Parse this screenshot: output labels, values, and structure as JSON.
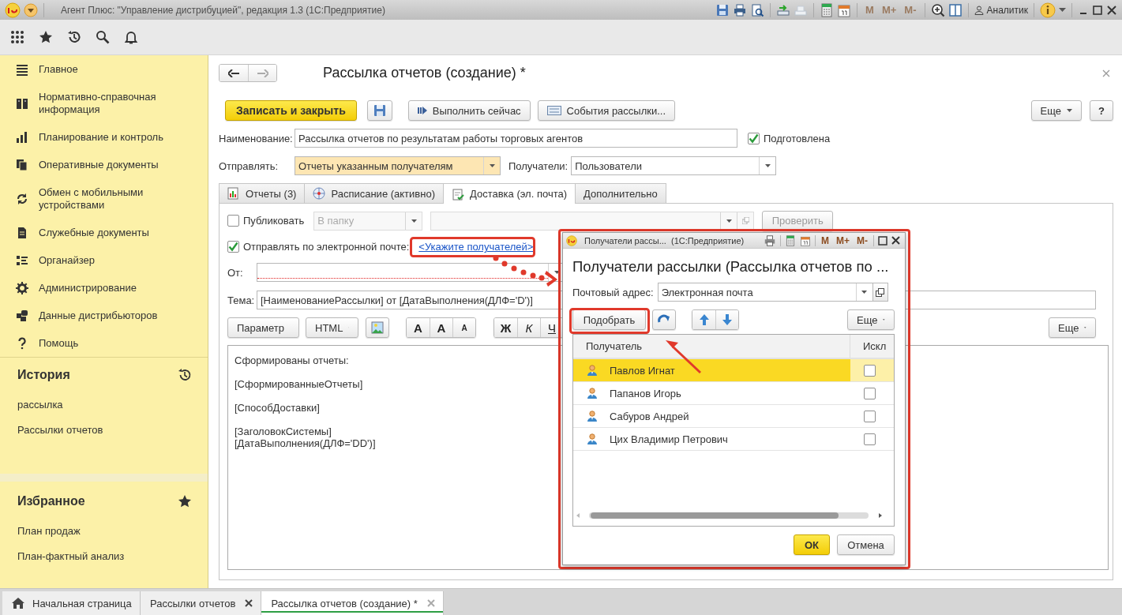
{
  "window": {
    "title": "Агент Плюс: \"Управление дистрибуцией\", редакция 1.3  (1С:Предприятие)",
    "user": "Аналитик",
    "memory_buttons": [
      {
        "label": "M",
        "disabled": true
      },
      {
        "label": "M+",
        "disabled": true
      },
      {
        "label": "M-",
        "disabled": true
      }
    ]
  },
  "sidebar": {
    "sections": [
      {
        "label": "Главное"
      },
      {
        "label": "Нормативно-справочная информация"
      },
      {
        "label": "Планирование и контроль"
      },
      {
        "label": "Оперативные документы"
      },
      {
        "label": "Обмен с мобильными устройствами"
      },
      {
        "label": "Служебные документы"
      },
      {
        "label": "Органайзер"
      },
      {
        "label": "Администрирование"
      },
      {
        "label": "Данные дистрибьюторов"
      },
      {
        "label": "Помощь"
      }
    ],
    "history": {
      "title": "История",
      "items": [
        "рассылка",
        "Рассылки отчетов"
      ]
    },
    "favorites": {
      "title": "Избранное",
      "items": [
        "План продаж",
        "План-фактный анализ"
      ]
    }
  },
  "form": {
    "title": "Рассылка отчетов (создание) *",
    "buttons": [
      {
        "kind": "primary",
        "label": "Записать и закрыть"
      },
      {
        "kind": "save"
      },
      {
        "kind": "run",
        "label": "Выполнить сейчас"
      },
      {
        "kind": "events",
        "label": "События рассылки..."
      }
    ],
    "more_button": "Еще",
    "help_button": "?",
    "name_field": {
      "label": "Наименование:",
      "value": "Рассылка отчетов по результатам работы торговых агентов"
    },
    "prepared": {
      "label": "Подготовлена",
      "checked": true
    },
    "send_field": {
      "label": "Отправлять:",
      "value": "Отчеты указанным получателям"
    },
    "recipients_field": {
      "label": "Получатели:",
      "value": "Пользователи"
    },
    "tabs": [
      {
        "label": "Отчеты (3)",
        "selected": false
      },
      {
        "label": "Расписание (активно)",
        "selected": false
      },
      {
        "label": "Доставка (эл. почта)",
        "selected": true
      },
      {
        "label": "Дополнительно",
        "selected": false
      }
    ],
    "delivery": {
      "publish": {
        "label": "Публиковать",
        "checked": false,
        "folder": "В папку",
        "check_button": "Проверить"
      },
      "email": {
        "label": "Отправлять по электронной почте:",
        "checked": true,
        "link": "<Укажите получателей>"
      },
      "from": {
        "label": "От:"
      },
      "subject": {
        "label": "Тема:",
        "value": "[НаименованиеРассылки] от [ДатаВыполнения(ДЛФ='D')]"
      },
      "toolbar": {
        "param": "Параметр",
        "format": "HTML",
        "font_buttons": [
          "A",
          "A",
          "A"
        ],
        "style_buttons": [
          "Ж",
          "К",
          "Ч"
        ],
        "more": "Еще"
      },
      "body": [
        [
          "Сформированы отчеты:"
        ],
        [
          "[СформированныеОтчеты]"
        ],
        [
          "[СпособДоставки]"
        ],
        [
          "[ЗаголовокСистемы]",
          "[ДатаВыполнения(ДЛФ='DD')]"
        ]
      ]
    }
  },
  "dialog": {
    "window_title": "Получатели рассы...  (1С:Предприятие)",
    "memory_buttons": [
      {
        "label": "M",
        "disabled": false
      },
      {
        "label": "M+",
        "disabled": false
      },
      {
        "label": "M-",
        "disabled": false
      }
    ],
    "title": "Получатели рассылки (Рассылка отчетов по ...",
    "address": {
      "label": "Почтовый адрес:",
      "value": "Электронная почта"
    },
    "pick_button": "Подобрать",
    "more_button": "Еще",
    "columns": [
      "Получатель",
      "Искл"
    ],
    "rows": [
      {
        "name": "Павлов Игнат",
        "selected": true,
        "excluded": false
      },
      {
        "name": "Папанов Игорь",
        "selected": false,
        "excluded": false
      },
      {
        "name": "Сабуров Андрей",
        "selected": false,
        "excluded": false
      },
      {
        "name": "Цих Владимир Петрович",
        "selected": false,
        "excluded": false
      }
    ],
    "ok_button": "ОК",
    "cancel_button": "Отмена"
  },
  "bottom_tabs": [
    {
      "kind": "home",
      "label": "Начальная страница",
      "selected": false,
      "closable": false
    },
    {
      "kind": "page",
      "label": "Рассылки отчетов",
      "selected": false,
      "closable": true
    },
    {
      "kind": "page",
      "label": "Рассылка отчетов (создание) *",
      "selected": true,
      "closable": true
    }
  ]
}
